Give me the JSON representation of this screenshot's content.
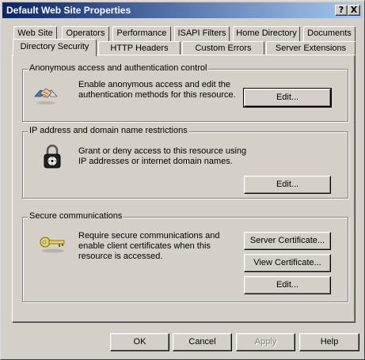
{
  "window": {
    "title": "Default Web Site Properties",
    "help_glyph": "?",
    "close_glyph": "X"
  },
  "tabs_row1": [
    "Web Site",
    "Operators",
    "Performance",
    "ISAPI Filters",
    "Home Directory",
    "Documents"
  ],
  "tabs_row2": [
    "Directory Security",
    "HTTP Headers",
    "Custom Errors",
    "Server Extensions"
  ],
  "active_tab": "Directory Security",
  "groups": {
    "anonymous": {
      "label": "Anonymous access and authentication control",
      "description": [
        "Enable anonymous access and edit the",
        "authentication methods for this resource."
      ],
      "icon": "handshake-icon",
      "edit_label": "Edit..."
    },
    "ip": {
      "label": "IP address and domain name restrictions",
      "description": [
        "Grant or deny access to this resource using",
        "IP addresses or internet domain names."
      ],
      "icon": "padlock-icon",
      "edit_label": "Edit..."
    },
    "secure": {
      "label": "Secure communications",
      "description": [
        "Require secure communications and",
        "enable client certificates when this",
        "resource is accessed."
      ],
      "icon": "key-icon",
      "server_cert_label": "Server Certificate...",
      "view_cert_label": "View Certificate...",
      "edit_label": "Edit..."
    }
  },
  "footer": {
    "ok_label": "OK",
    "cancel_label": "Cancel",
    "apply_label": "Apply",
    "help_label": "Help"
  }
}
